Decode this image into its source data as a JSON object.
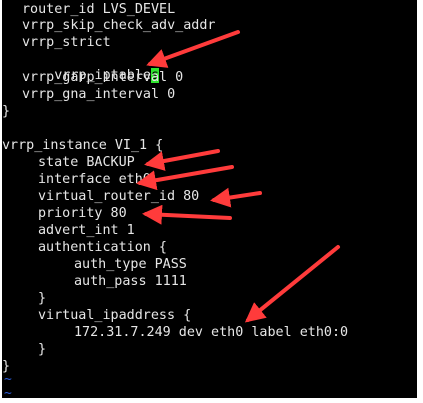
{
  "terminal": {
    "lines": [
      "router_id LVS_DEVEL",
      "vrrp_skip_check_adv_addr",
      "vrrp_strict",
      "vrrp_iptable",
      "vrrp_garp_interval 0",
      "vrrp_gna_interval 0",
      "}",
      "vrrp_instance VI_1 {",
      "state BACKUP",
      "interface eth0",
      "virtual_router_id 80",
      "priority 80",
      "advert_int 1",
      "authentication {",
      "auth_type PASS",
      "auth_pass 1111",
      "}",
      "virtual_ipaddress {",
      "172.31.7.249 dev eth0 label eth0:0",
      "}",
      "}",
      "~",
      "~"
    ],
    "cursor_char": "s",
    "accent_arrow_color": "#ff3b3b",
    "cursor_color": "#2fe52f"
  }
}
